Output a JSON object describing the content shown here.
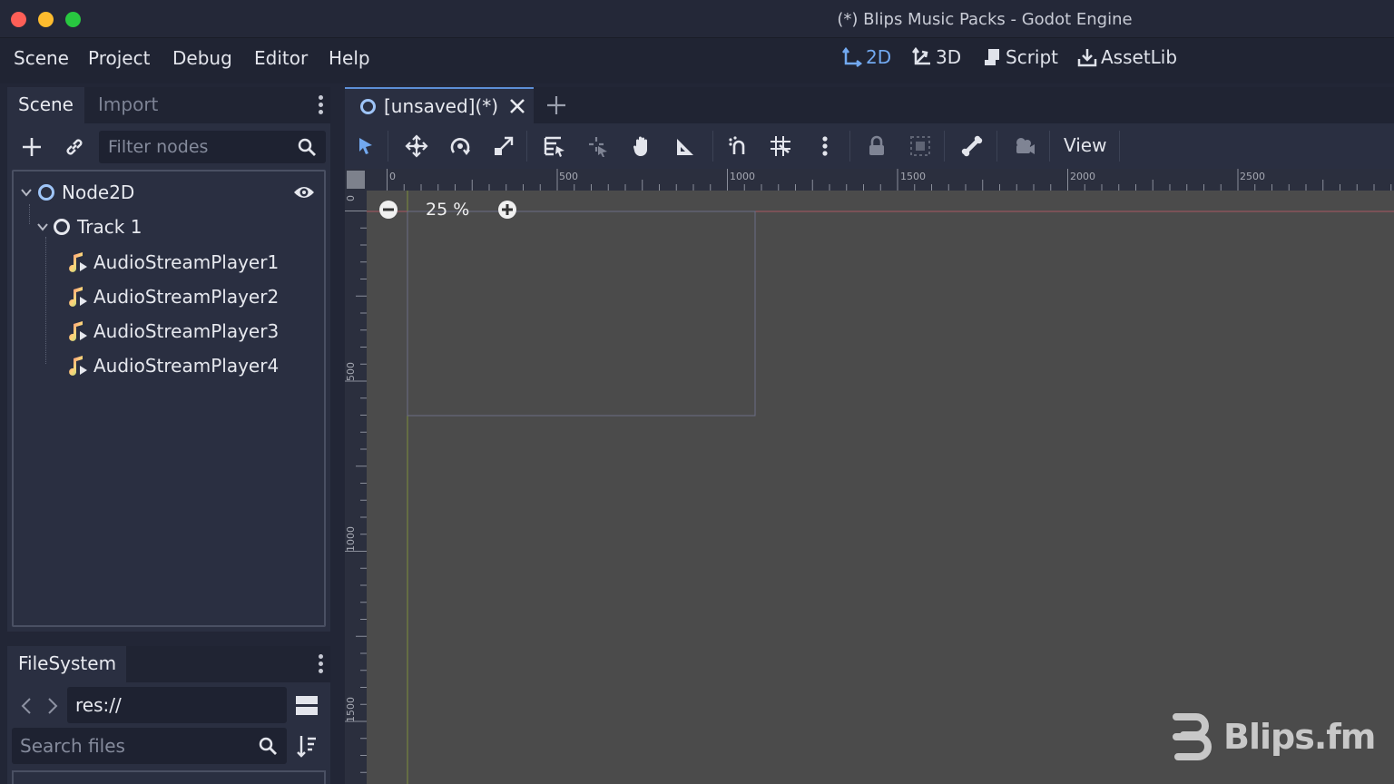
{
  "window": {
    "title": "(*) Blips Music Packs - Godot Engine"
  },
  "menu": {
    "items": [
      "Scene",
      "Project",
      "Debug",
      "Editor",
      "Help"
    ],
    "workspaces": [
      {
        "label": "2D",
        "icon": "2d-icon",
        "active": true
      },
      {
        "label": "3D",
        "icon": "3d-icon",
        "active": false
      },
      {
        "label": "Script",
        "icon": "script-icon",
        "active": false
      },
      {
        "label": "AssetLib",
        "icon": "download-icon",
        "active": false
      }
    ]
  },
  "scene_dock": {
    "tabs": [
      "Scene",
      "Import"
    ],
    "active_tab": "Scene",
    "filter_placeholder": "Filter nodes",
    "tree": [
      {
        "label": "Node2D",
        "type": "Node2D",
        "depth": 0,
        "expanded": true,
        "visible_toggle": true
      },
      {
        "label": "Track 1",
        "type": "Node",
        "depth": 1,
        "expanded": true
      },
      {
        "label": "AudioStreamPlayer1",
        "type": "AudioStreamPlayer",
        "depth": 2
      },
      {
        "label": "AudioStreamPlayer2",
        "type": "AudioStreamPlayer",
        "depth": 2
      },
      {
        "label": "AudioStreamPlayer3",
        "type": "AudioStreamPlayer",
        "depth": 2
      },
      {
        "label": "AudioStreamPlayer4",
        "type": "AudioStreamPlayer",
        "depth": 2
      }
    ]
  },
  "filesystem_dock": {
    "tab": "FileSystem",
    "path": "res://",
    "search_placeholder": "Search files"
  },
  "editor": {
    "scene_tab": "[unsaved](*)",
    "toolbar_view_label": "View",
    "zoom": "25 %",
    "ruler_h_labels": [
      "0",
      "500",
      "1000",
      "1500",
      "2000",
      "2500"
    ],
    "ruler_v_labels": [
      "0",
      "500",
      "1000",
      "1500"
    ]
  },
  "watermark": {
    "text": "Blips.fm"
  },
  "colors": {
    "accent": "#72a9f0",
    "panel": "#2a2f41",
    "background": "#202433",
    "viewport": "#4b4b4b"
  }
}
